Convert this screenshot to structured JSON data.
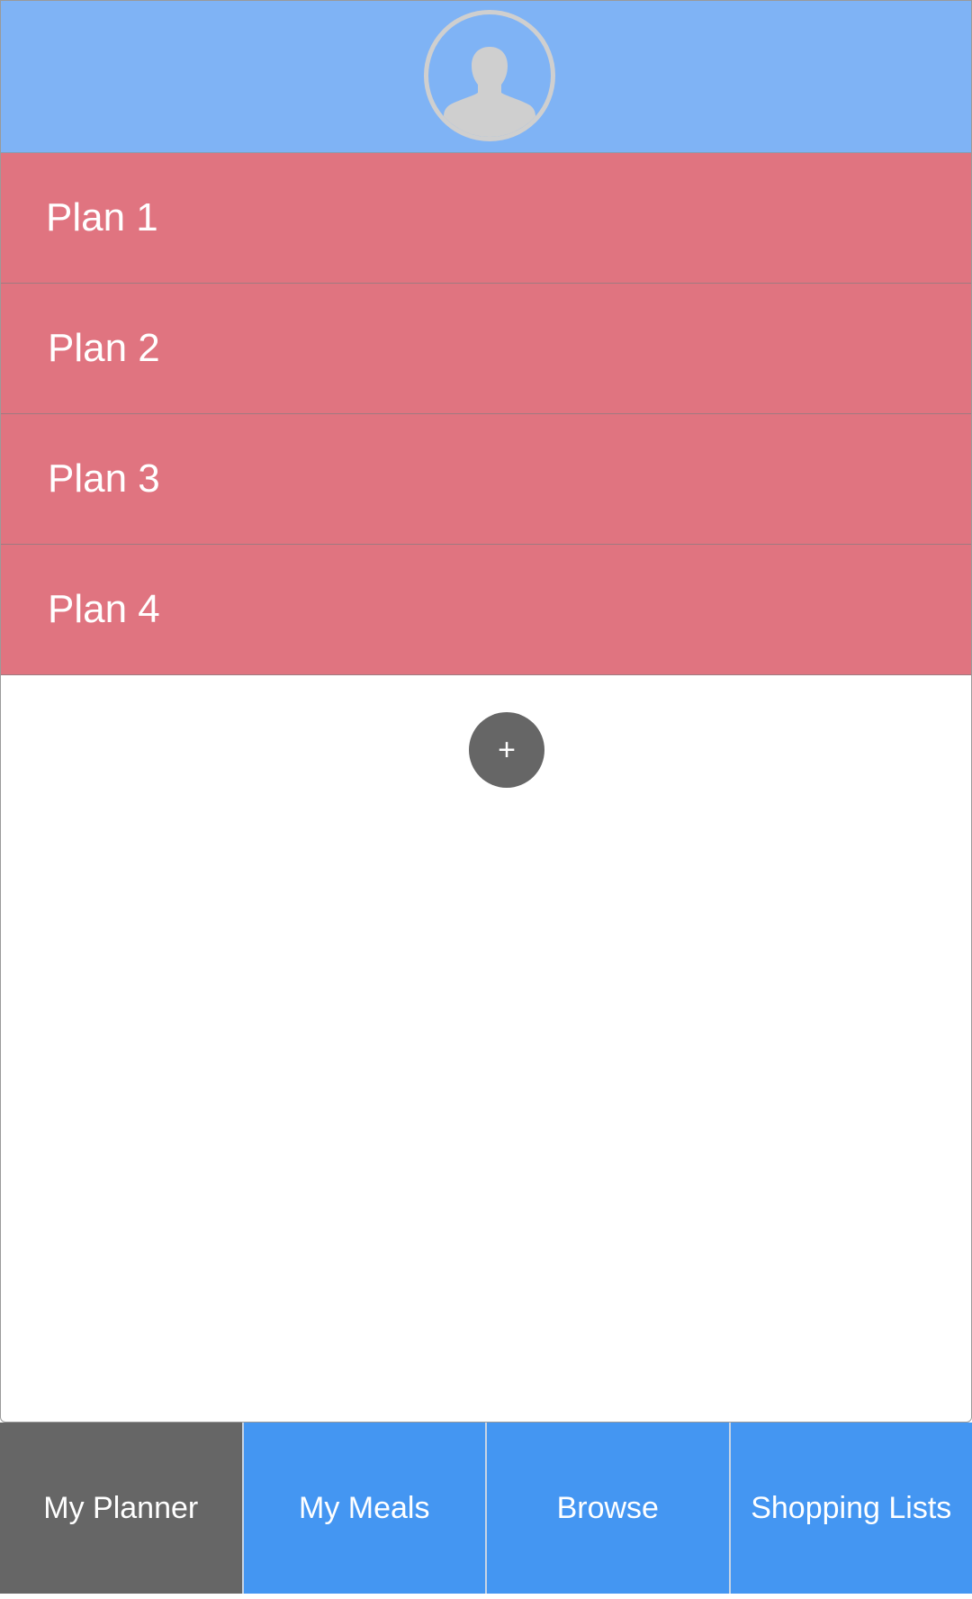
{
  "header": {
    "avatar_icon": "user-avatar-icon",
    "background_color": "#7fb3f5"
  },
  "plans": [
    {
      "label": "Plan 1"
    },
    {
      "label": "Plan 2"
    },
    {
      "label": "Plan 3"
    },
    {
      "label": "Plan 4"
    }
  ],
  "plan_row_color": "#e07480",
  "add_button": {
    "label": "+",
    "icon": "plus-icon"
  },
  "tabs": [
    {
      "label": "My Planner",
      "active": true
    },
    {
      "label": "My Meals",
      "active": false
    },
    {
      "label": "Browse",
      "active": false
    },
    {
      "label": "Shopping Lists",
      "active": false
    }
  ],
  "colors": {
    "tab_active": "#666666",
    "tab_inactive": "#4496f2"
  }
}
